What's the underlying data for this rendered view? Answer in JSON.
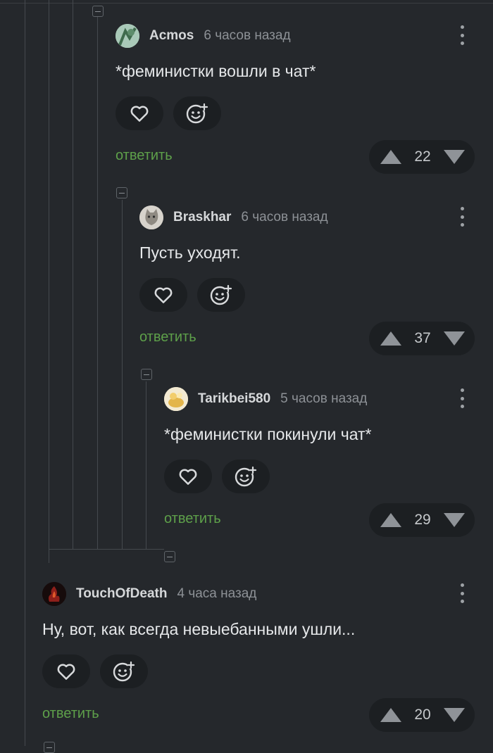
{
  "comments": [
    {
      "author": "Acmos",
      "time": "6 часов назад",
      "text": "*феминистки вошли в чат*",
      "reply": "ответить",
      "score": "22"
    },
    {
      "author": "Braskhar",
      "time": "6 часов назад",
      "text": "Пусть уходят.",
      "reply": "ответить",
      "score": "37"
    },
    {
      "author": "Tarikbei580",
      "time": "5 часов назад",
      "text": "*феминистки покинули чат*",
      "reply": "ответить",
      "score": "29"
    },
    {
      "author": "TouchOfDeath",
      "time": "4 часа назад",
      "text": "Ну, вот, как всегда невыебанными ушли...",
      "reply": "ответить",
      "score": "20"
    }
  ],
  "icons": {
    "like": "heart-icon",
    "reaction": "add-emoji-icon",
    "upvote": "upvote-arrow-icon",
    "downvote": "downvote-arrow-icon",
    "menu": "more-vertical-icon",
    "collapse": "collapse-minus-icon"
  },
  "colors": {
    "background": "#25282c",
    "reply_link": "#5ea04a",
    "pill": "#1c1f22"
  }
}
